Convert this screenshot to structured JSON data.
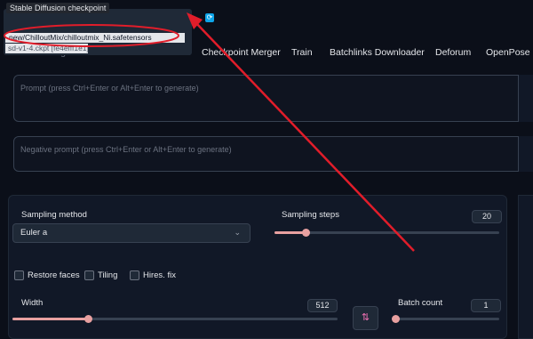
{
  "checkpoint": {
    "label": "Stable Diffusion checkpoint",
    "options": [
      "new/ChilloutMix/chilloutmix_Ni.safetensors",
      "sd-v1-4.ckpt [fe4efff1e1]"
    ],
    "refresh_icon": "refresh-icon"
  },
  "tabs": [
    {
      "label": "Checkpoint Merger"
    },
    {
      "label": "Train"
    },
    {
      "label": "Batchlinks Downloader"
    },
    {
      "label": "Deforum"
    },
    {
      "label": "OpenPose Ed"
    }
  ],
  "prompts": {
    "positive_placeholder": "Prompt (press Ctrl+Enter or Alt+Enter to generate)",
    "negative_placeholder": "Negative prompt (press Ctrl+Enter or Alt+Enter to generate)"
  },
  "settings": {
    "sampling_method_label": "Sampling method",
    "sampling_method_value": "Euler a",
    "sampling_steps_label": "Sampling steps",
    "sampling_steps_value": "20",
    "restore_faces_label": "Restore faces",
    "tiling_label": "Tiling",
    "hires_fix_label": "Hires. fix",
    "width_label": "Width",
    "width_value": "512",
    "batch_count_label": "Batch count",
    "batch_count_value": "1",
    "swap_icon": "swap-icon"
  },
  "colors": {
    "background": "#0b0f19",
    "annotation_red": "#e11d2a",
    "slider_accent": "#e8a0a0"
  }
}
